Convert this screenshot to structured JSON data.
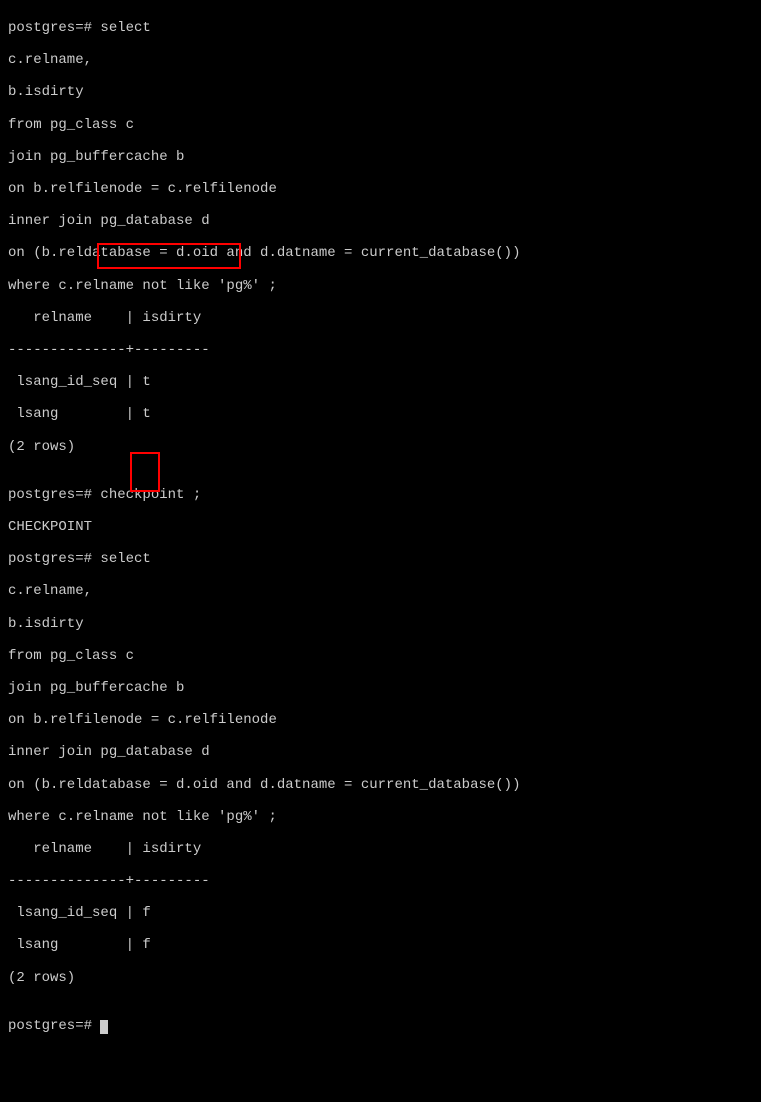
{
  "prompt": "postgres=# ",
  "sql": {
    "select": "select",
    "col1": "c.relname,",
    "col2": "b.isdirty",
    "from": "from pg_class c",
    "join1": "join pg_buffercache b",
    "on1": "on b.relfilenode = c.relfilenode",
    "join2": "inner join pg_database d",
    "on2": "on (b.reldatabase = d.oid and d.datname = current_database())",
    "where": "where c.relname not like 'pg%' ;"
  },
  "header": "   relname    | isdirty ",
  "divider": "--------------+---------",
  "result1": {
    "row1": " lsang_id_seq | t",
    "row2": " lsang        | t",
    "count": "(2 rows)"
  },
  "checkpoint_cmd": "checkpoint ;",
  "checkpoint_resp": "CHECKPOINT",
  "result2": {
    "row1": " lsang_id_seq | f",
    "row2": " lsang        | f",
    "count": "(2 rows)"
  },
  "blank": ""
}
